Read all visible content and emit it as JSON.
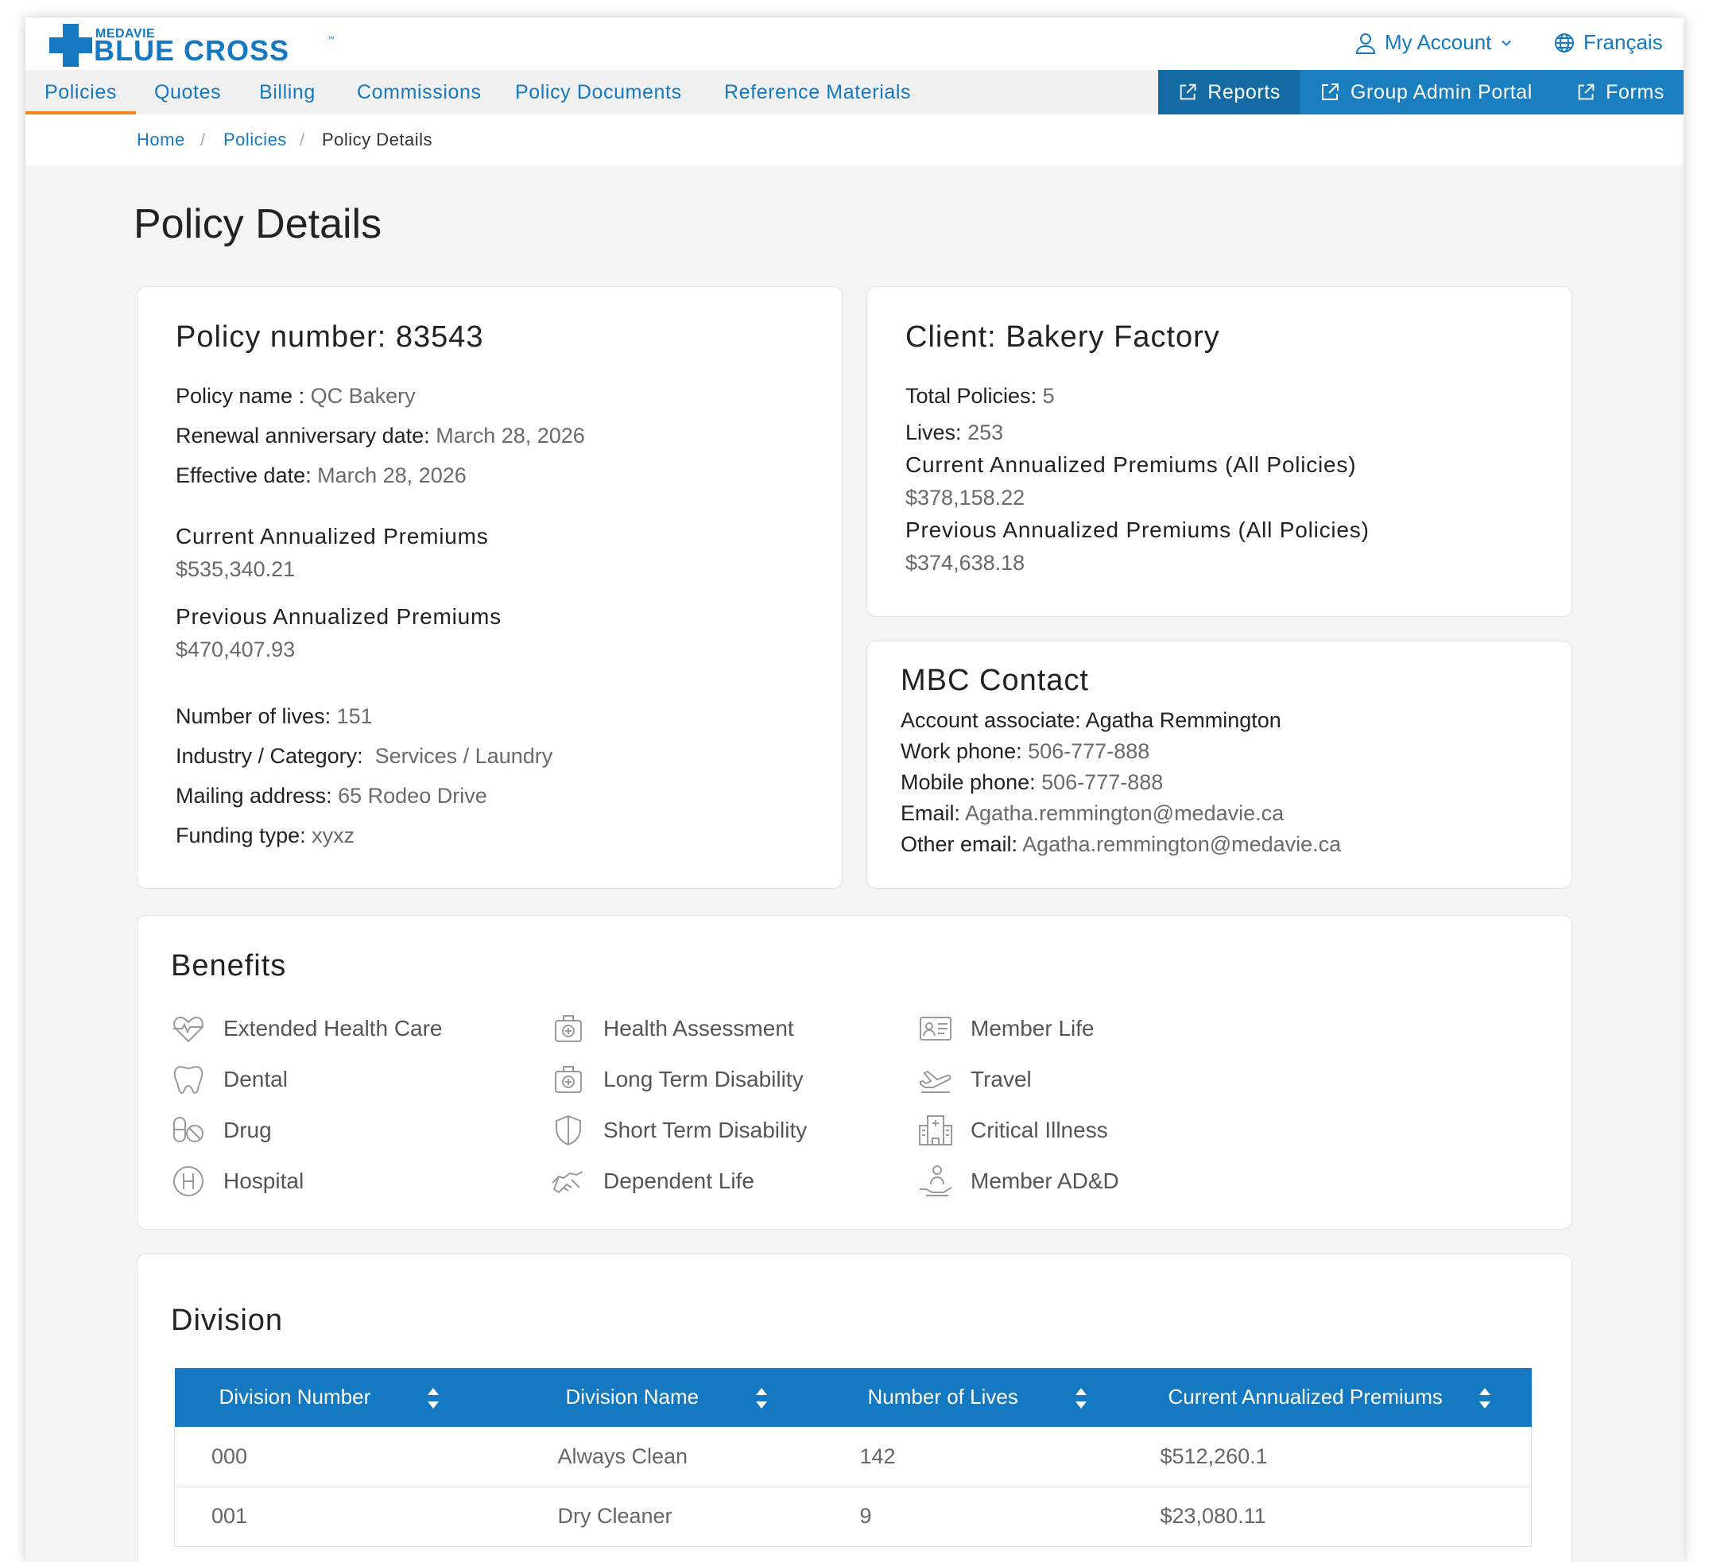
{
  "brand": {
    "small": "MEDAVIE",
    "big": "BLUE CROSS",
    "tm": "™"
  },
  "utility": {
    "account": "My Account",
    "language": "Français"
  },
  "nav": {
    "items": [
      "Policies",
      "Quotes",
      "Billing",
      "Commissions",
      "Policy Documents",
      "Reference Materials"
    ],
    "external": [
      "Reports",
      "Group Admin Portal",
      "Forms"
    ]
  },
  "breadcrumb": {
    "home": "Home",
    "policies": "Policies",
    "current": "Policy Details",
    "sep": "/"
  },
  "page_title": "Policy Details",
  "policy": {
    "heading": "Policy number: 83543",
    "name_label": "Policy name :",
    "name": "QC Bakery",
    "renewal_label": "Renewal anniversary date:",
    "renewal": "March 28, 2026",
    "effective_label": "Effective date:",
    "effective": "March 28, 2026",
    "current_label": "Current Annualized Premiums",
    "current": "$535,340.21",
    "previous_label": "Previous Annualized Premiums",
    "previous": "$470,407.93",
    "lives_label": "Number of lives:",
    "lives": "151",
    "industry_label": "Industry / Category:",
    "industry": "Services / Laundry",
    "address_label": "Mailing address:",
    "address": "65 Rodeo Drive",
    "funding_label": "Funding type:",
    "funding": "xyxz"
  },
  "client": {
    "heading": "Client: Bakery Factory",
    "total_label": "Total Policies:",
    "total": "5",
    "lives_label": "Lives:",
    "lives": "253",
    "current_label": "Current Annualized Premiums (All Policies)",
    "current": "$378,158.22",
    "previous_label": "Previous Annualized Premiums (All Policies)",
    "previous": "$374,638.18"
  },
  "contact": {
    "heading": "MBC Contact",
    "associate_label": "Account associate:",
    "associate": "Agatha Remmington",
    "work_label": "Work phone:",
    "work": "506-777-888",
    "mobile_label": "Mobile phone:",
    "mobile": "506-777-888",
    "email_label": "Email:",
    "email": "Agatha.remmington@medavie.ca",
    "other_label": "Other email:",
    "other": "Agatha.remmington@medavie.ca"
  },
  "benefits": {
    "heading": "Benefits",
    "items": [
      {
        "label": "Extended Health Care",
        "icon": "heartbeat-icon"
      },
      {
        "label": "Dental",
        "icon": "tooth-icon"
      },
      {
        "label": "Drug",
        "icon": "pills-icon"
      },
      {
        "label": "Hospital",
        "icon": "hospital-h-icon"
      },
      {
        "label": "Health Assessment",
        "icon": "medical-kit-icon"
      },
      {
        "label": "Long Term Disability",
        "icon": "medical-kit-icon"
      },
      {
        "label": "Short Term Disability",
        "icon": "shield-icon"
      },
      {
        "label": "Dependent Life",
        "icon": "handshake-icon"
      },
      {
        "label": "Member Life",
        "icon": "id-card-icon"
      },
      {
        "label": "Travel",
        "icon": "airplane-icon"
      },
      {
        "label": "Critical Illness",
        "icon": "hospital-building-icon"
      },
      {
        "label": "Member AD&D",
        "icon": "hand-person-icon"
      }
    ]
  },
  "division": {
    "heading": "Division",
    "columns": [
      "Division Number",
      "Division Name",
      "Number of Lives",
      "Current Annualized Premiums"
    ],
    "rows": [
      [
        "000",
        "Always Clean",
        "142",
        "$512,260.1"
      ],
      [
        "001",
        "Dry Cleaner",
        "9",
        "$23,080.11"
      ]
    ]
  },
  "colors": {
    "brand_blue": "#1479c0",
    "accent_orange": "#f4861f",
    "nav_blue": "#1a7ebf"
  }
}
